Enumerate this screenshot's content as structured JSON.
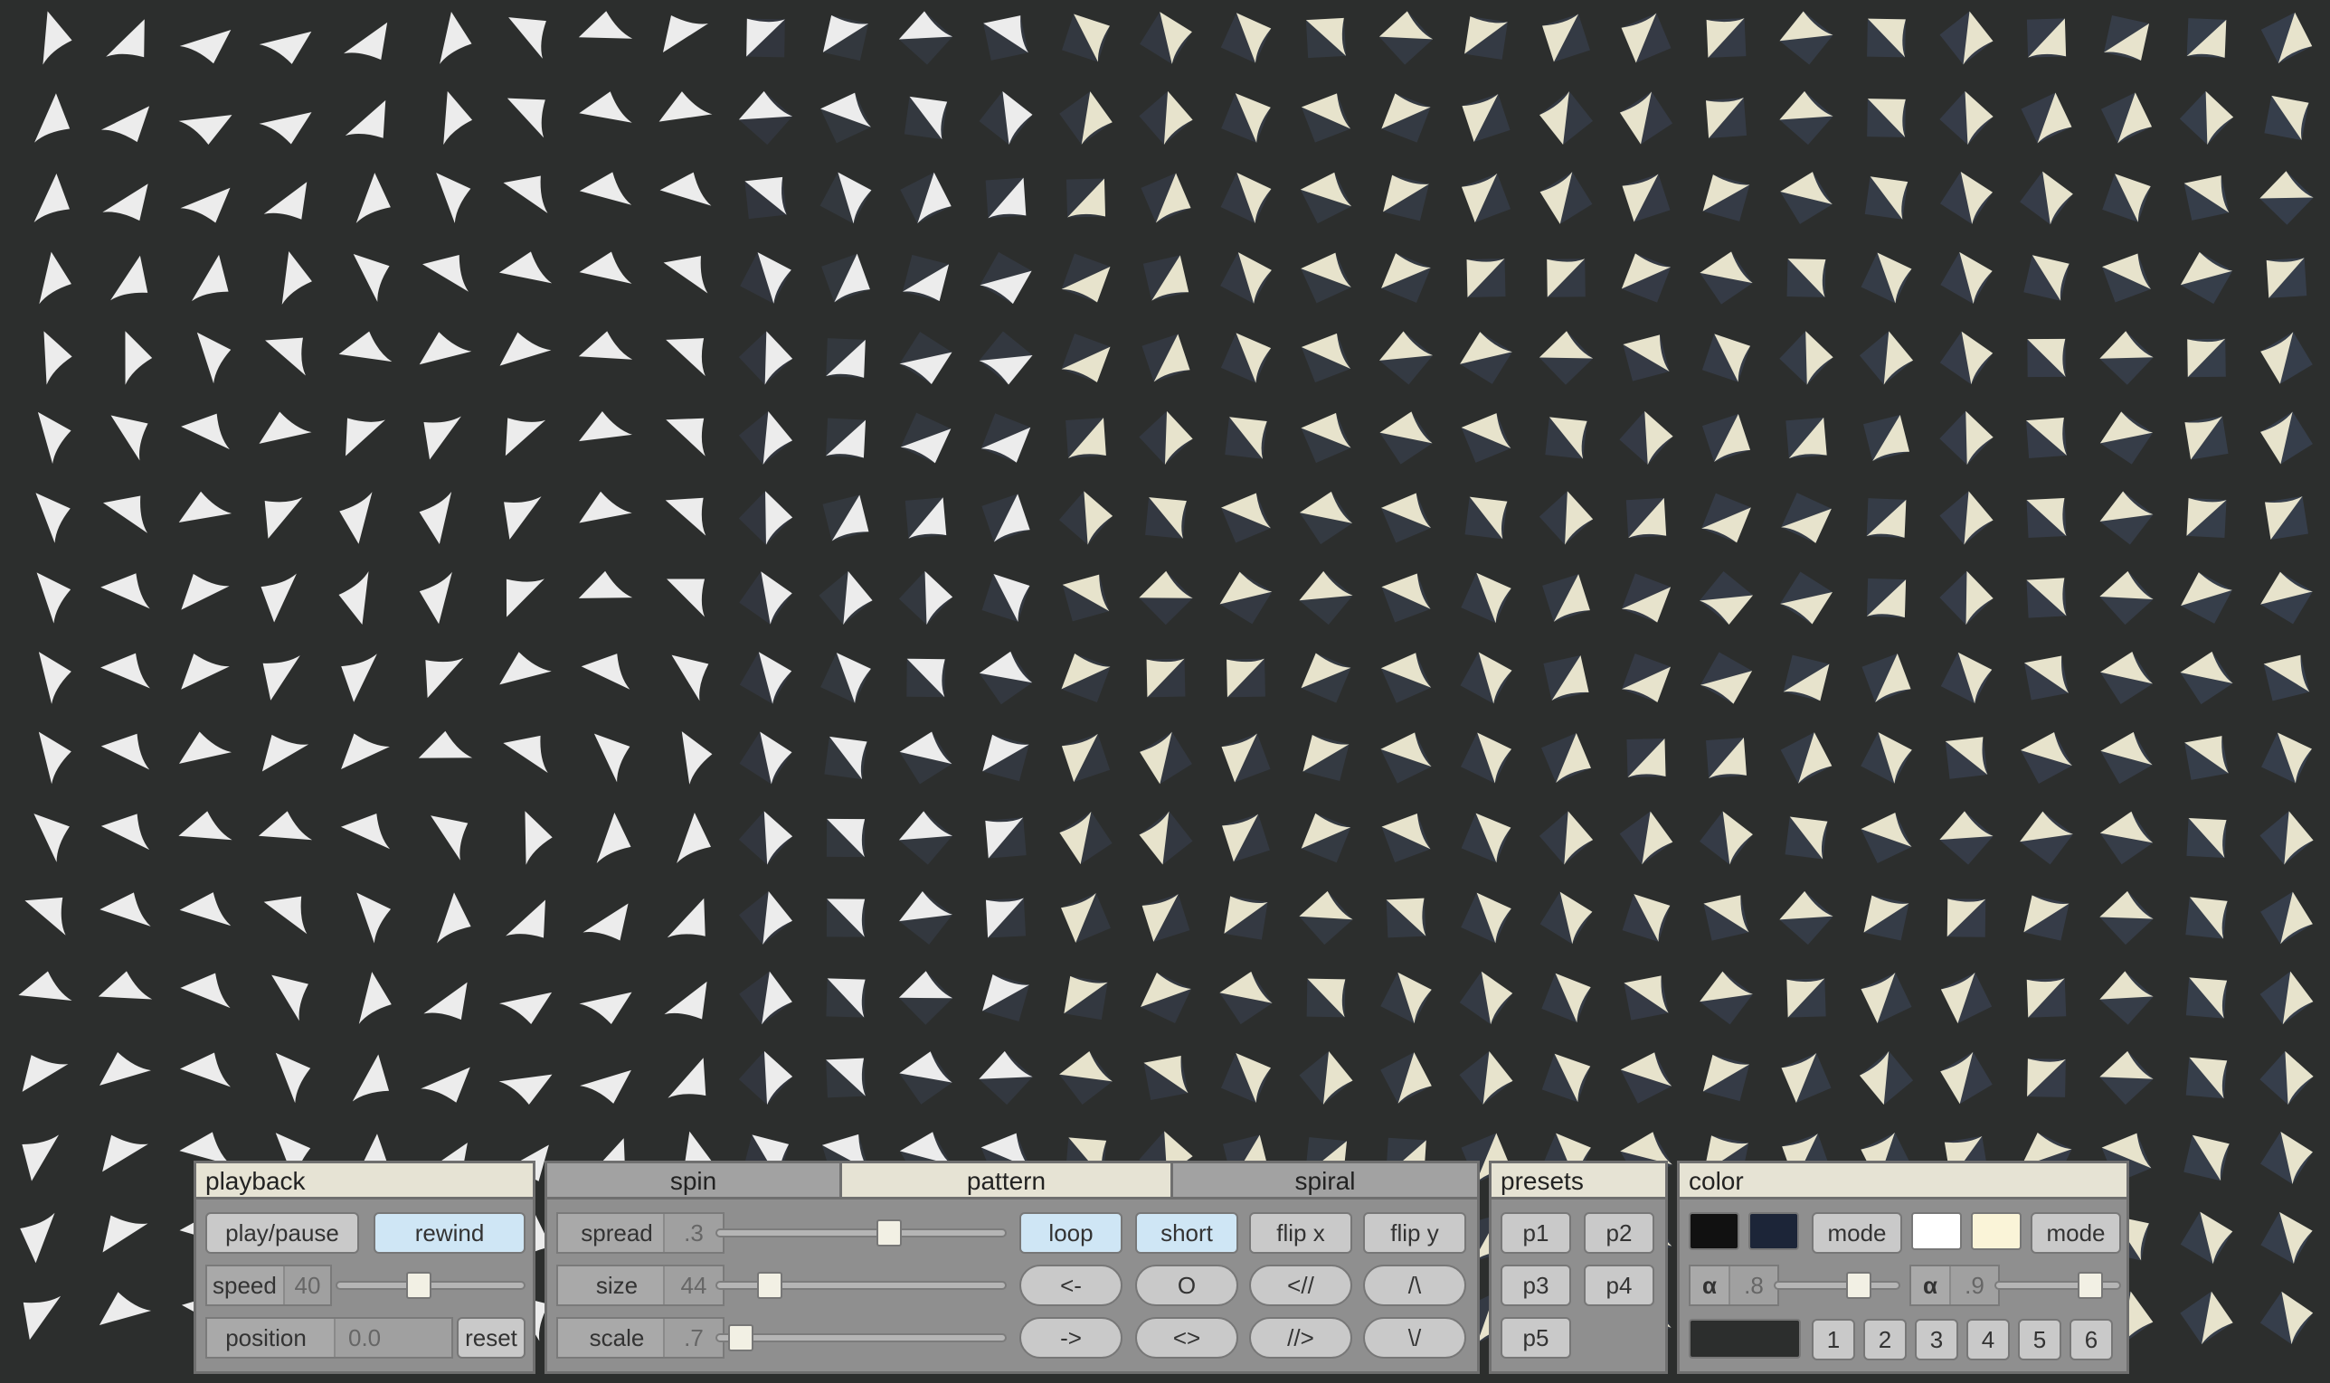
{
  "canvas": {
    "bg": "#2c2e2d",
    "shape_light": "#ececec",
    "shape_cream": "#e7e3cc",
    "shape_shadow": "#3a4252"
  },
  "playback": {
    "title": "playback",
    "play_pause": "play/pause",
    "rewind": "rewind",
    "speed_label": "speed",
    "speed_value": "40",
    "speed_level": 0.42,
    "position_label": "position",
    "position_value": "0.0",
    "reset": "reset"
  },
  "tabs": {
    "spin": "spin",
    "pattern": "pattern",
    "spiral": "spiral",
    "active": "pattern"
  },
  "pattern": {
    "spread_label": "spread",
    "spread_value": ".3",
    "spread_level": 0.6,
    "size_label": "size",
    "size_value": "44",
    "size_level": 0.15,
    "scale_label": "scale",
    "scale_value": ".7",
    "scale_level": 0.04,
    "loop": "loop",
    "short": "short",
    "flip_x": "flip x",
    "flip_y": "flip y",
    "arrow_left": "<-",
    "circle": "O",
    "fwd_left": "<//",
    "up": "/\\",
    "arrow_right": "->",
    "both": "<>",
    "fwd_right": "//>",
    "down": "\\/"
  },
  "presets": {
    "title": "presets",
    "items": [
      "p1",
      "p2",
      "p3",
      "p4",
      "p5"
    ]
  },
  "color": {
    "title": "color",
    "swatch1": "#111111",
    "swatch2": "#1c2538",
    "mode1": "mode",
    "swatch3": "#ffffff",
    "swatch4": "#faf4d8",
    "mode2": "mode",
    "alpha_symbol": "α",
    "alpha1_value": ".8",
    "alpha1_level": 0.7,
    "alpha2_value": ".9",
    "alpha2_level": 0.8,
    "bg_swatch": "#2c2e2d",
    "numbers": [
      "1",
      "2",
      "3",
      "4",
      "5",
      "6"
    ]
  }
}
